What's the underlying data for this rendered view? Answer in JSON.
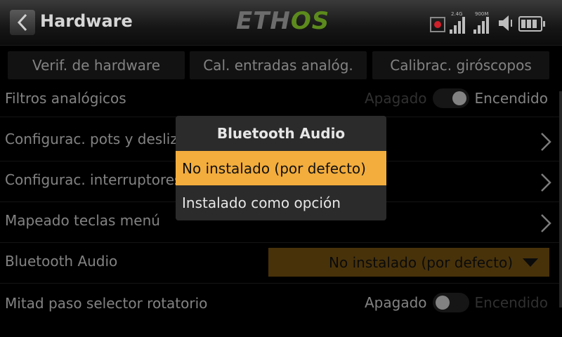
{
  "header": {
    "title": "Hardware",
    "logo_left": "ETH",
    "logo_right": "OS",
    "signal_24": "2.4G",
    "signal_900": "900M"
  },
  "tabs": [
    {
      "label": "Verif. de hardware"
    },
    {
      "label": "Cal. entradas analóg."
    },
    {
      "label": "Calibrac. giróscopos"
    }
  ],
  "rows": {
    "analog_filters": {
      "label": "Filtros analógicos",
      "off": "Apagado",
      "on": "Encendido",
      "state": "on"
    },
    "pots_sliders": {
      "label": "Configurac. pots y desliz"
    },
    "switches": {
      "label": "Configurac. interruptores"
    },
    "menu_keys": {
      "label": "Mapeado teclas menú"
    },
    "bluetooth": {
      "label": "Bluetooth Audio",
      "value": "No instalado (por defecto)"
    },
    "rotary_half": {
      "label": "Mitad paso selector rotatorio",
      "off": "Apagado",
      "on": "Encendido",
      "state": "off"
    }
  },
  "dialog": {
    "title": "Bluetooth Audio",
    "options": [
      {
        "label": "No instalado (por defecto)",
        "selected": true
      },
      {
        "label": "Instalado como opción",
        "selected": false
      }
    ]
  },
  "colors": {
    "accent": "#f3ad3c",
    "brand_green": "#5c8a1c",
    "record": "#d0202a"
  }
}
